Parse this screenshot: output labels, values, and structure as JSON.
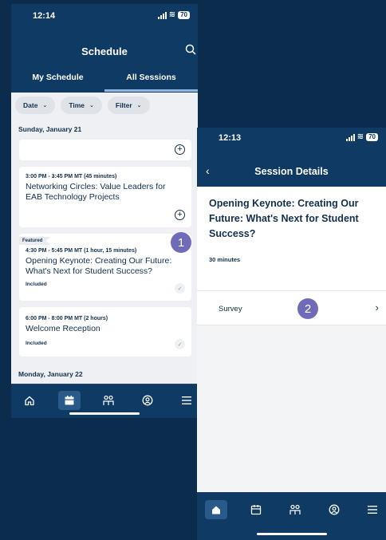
{
  "phone1": {
    "status": {
      "time": "12:14",
      "battery": "70"
    },
    "title": "Schedule",
    "tabs": [
      "My Schedule",
      "All Sessions"
    ],
    "filters": [
      "Date",
      "Time",
      "Filter"
    ],
    "day1": "Sunday, January 21",
    "sessions": [
      {
        "time": "3:00 PM - 3:45 PM MT (45 minutes)",
        "name": "Networking Circles: Value Leaders for EAB Technology Projects"
      },
      {
        "badge": "Featured",
        "time": "4:30 PM - 5:45 PM MT (1 hour, 15 minutes)",
        "name": "Opening Keynote: Creating Our Future: What's Next for Student Success?",
        "status": "Included"
      },
      {
        "time": "6:00 PM - 8:00 PM MT (2 hours)",
        "name": "Welcome Reception",
        "status": "Included"
      }
    ],
    "day2": "Monday, January 22",
    "marker": "1"
  },
  "phone2": {
    "status": {
      "time": "12:13",
      "battery": "70"
    },
    "title": "Session Details",
    "session_name": "Opening Keynote: Creating Our Future: What's Next for Student Success?",
    "duration": "30 minutes",
    "survey_label": "Survey",
    "marker": "2"
  },
  "colors": {
    "navy": "#0e3a63",
    "marker": "#6f6bb8",
    "accent": "#8fb6dc"
  }
}
